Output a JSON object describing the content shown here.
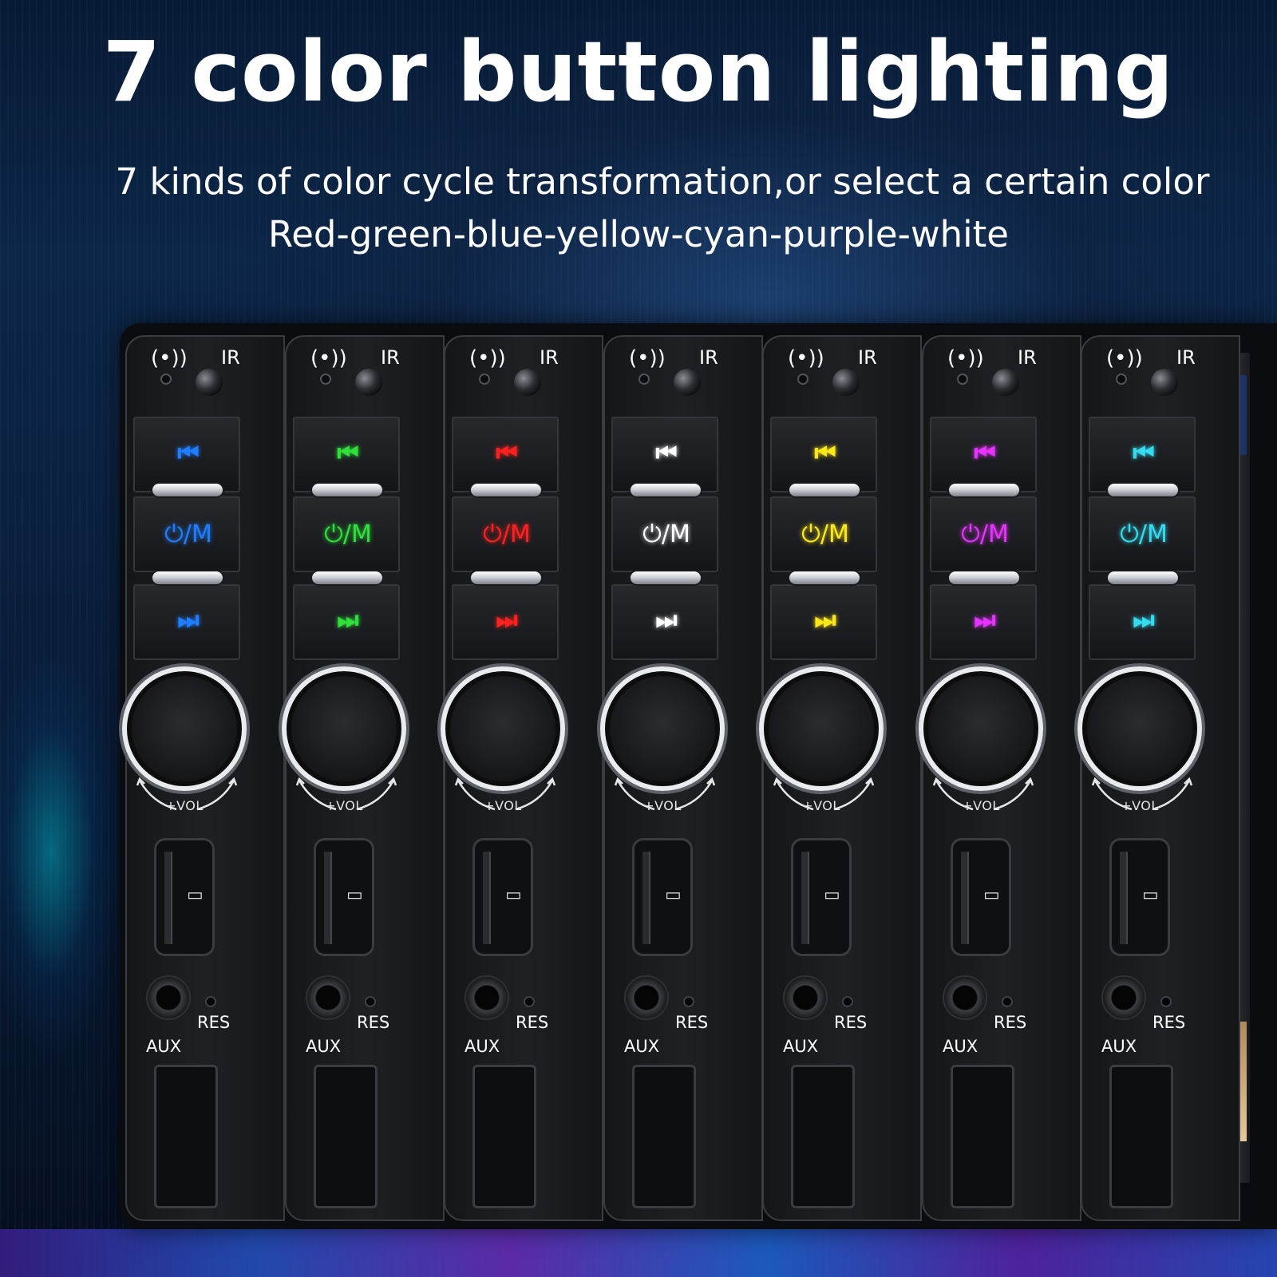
{
  "headline": "7 color button lighting",
  "subtitle_1": "7 kinds of color cycle transformation,or select a certain color",
  "subtitle_2": "Red-green-blue-yellow-cyan-purple-white",
  "panel_labels": {
    "ir": "IR",
    "power_mode": "⏻/M",
    "prev": "⏮",
    "next": "⏭",
    "volume": "+VOL-",
    "res": "RES",
    "aux": "AUX"
  },
  "units": [
    {
      "color_name": "blue",
      "color": "#1f7dff"
    },
    {
      "color_name": "green",
      "color": "#2fe03a"
    },
    {
      "color_name": "red",
      "color": "#ff2020"
    },
    {
      "color_name": "white",
      "color": "#ffffff"
    },
    {
      "color_name": "yellow",
      "color": "#ffe81a"
    },
    {
      "color_name": "purple",
      "color": "#e633ff"
    },
    {
      "color_name": "cyan",
      "color": "#35dcf0"
    }
  ]
}
